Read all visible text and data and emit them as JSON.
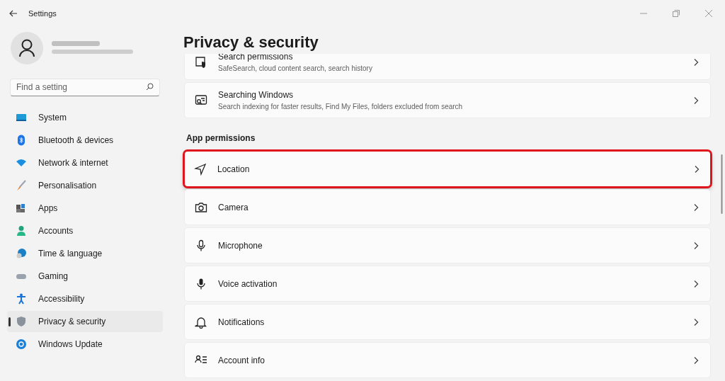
{
  "window": {
    "title": "Settings"
  },
  "search": {
    "placeholder": "Find a setting"
  },
  "sidebar": {
    "items": [
      {
        "label": "System",
        "kind": "system",
        "selected": false
      },
      {
        "label": "Bluetooth & devices",
        "kind": "bluetooth",
        "selected": false
      },
      {
        "label": "Network & internet",
        "kind": "network",
        "selected": false
      },
      {
        "label": "Personalisation",
        "kind": "brush",
        "selected": false
      },
      {
        "label": "Apps",
        "kind": "apps",
        "selected": false
      },
      {
        "label": "Accounts",
        "kind": "accounts",
        "selected": false
      },
      {
        "label": "Time & language",
        "kind": "time",
        "selected": false
      },
      {
        "label": "Gaming",
        "kind": "gaming",
        "selected": false
      },
      {
        "label": "Accessibility",
        "kind": "accessibility",
        "selected": false
      },
      {
        "label": "Privacy & security",
        "kind": "shield",
        "selected": true
      },
      {
        "label": "Windows Update",
        "kind": "update",
        "selected": false
      }
    ]
  },
  "page_title": "Privacy & security",
  "sections": [
    {
      "items": [
        {
          "title": "Search permissions",
          "subtitle": "SafeSearch, cloud content search, search history",
          "kind": "searchperm",
          "highlighted": false
        },
        {
          "title": "Searching Windows",
          "subtitle": "Search indexing for faster results, Find My Files, folders excluded from search",
          "kind": "searchwin",
          "highlighted": false
        }
      ]
    },
    {
      "heading": "App permissions",
      "items": [
        {
          "title": "Location",
          "kind": "location",
          "highlighted": true
        },
        {
          "title": "Camera",
          "kind": "camera",
          "highlighted": false
        },
        {
          "title": "Microphone",
          "kind": "mic",
          "highlighted": false
        },
        {
          "title": "Voice activation",
          "kind": "voice",
          "highlighted": false
        },
        {
          "title": "Notifications",
          "kind": "bell",
          "highlighted": false
        },
        {
          "title": "Account info",
          "kind": "account",
          "highlighted": false
        }
      ]
    }
  ]
}
